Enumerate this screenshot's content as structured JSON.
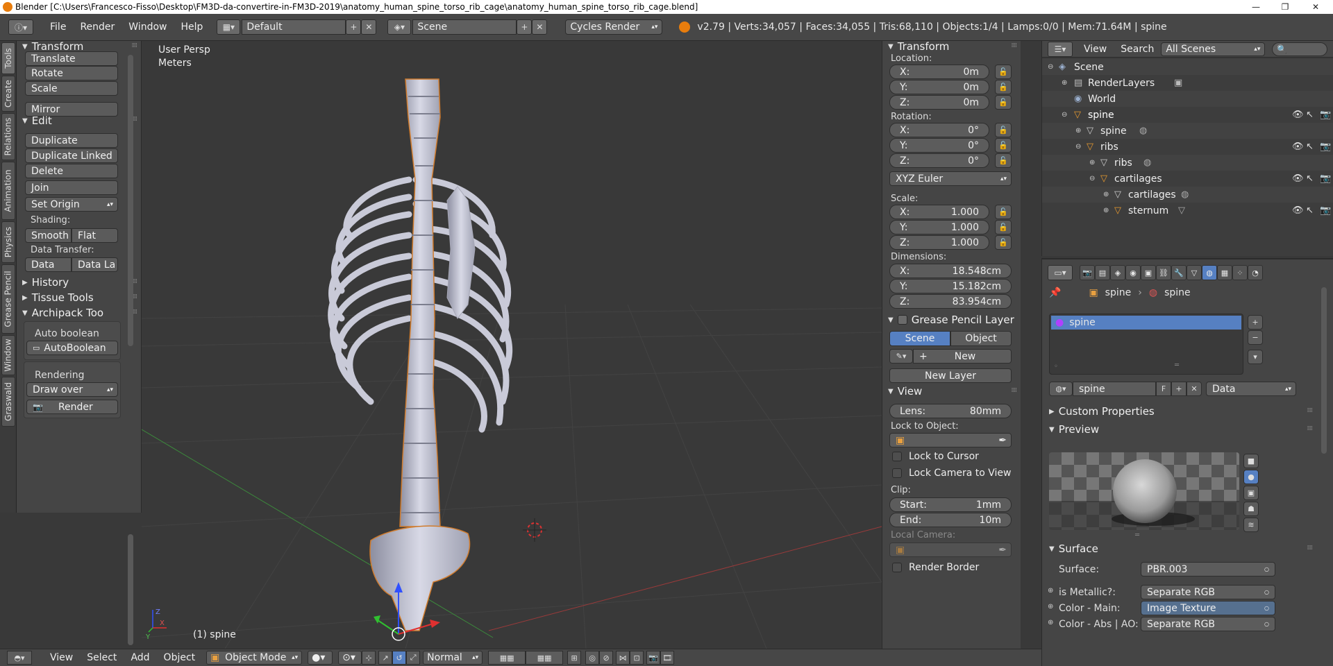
{
  "window": {
    "title": "Blender [C:\\Users\\Francesco-Fisso\\Desktop\\FM3D-da-convertire-in-FM3D-2019\\anatomy_human_spine_torso_rib_cage\\anatomy_human_spine_torso_rib_cage.blend]",
    "minimize": "—",
    "maximize": "❐",
    "close": "✕"
  },
  "header": {
    "menus": [
      "File",
      "Render",
      "Window",
      "Help"
    ],
    "screen_layout": "Default",
    "scene": "Scene",
    "render_engine": "Cycles Render",
    "stats": "v2.79 | Verts:34,057 | Faces:34,055 | Tris:68,110 | Objects:1/4 | Lamps:0/0 | Mem:71.64M | spine"
  },
  "tool_tabs": [
    "Tools",
    "Create",
    "Relations",
    "Animation",
    "Physics",
    "Grease Pencil",
    "Window",
    "Graswald"
  ],
  "toolshelf": {
    "transform": {
      "title": "Transform",
      "buttons": [
        "Translate",
        "Rotate",
        "Scale",
        "Mirror"
      ]
    },
    "edit": {
      "title": "Edit",
      "buttons": [
        "Duplicate",
        "Duplicate Linked",
        "Delete",
        "Join"
      ],
      "set_origin": "Set Origin",
      "shading_label": "Shading:",
      "smooth": "Smooth",
      "flat": "Flat",
      "data_transfer_label": "Data Transfer:",
      "data": "Data",
      "data_layout": "Data La"
    },
    "history": "History",
    "tissue_tools": "Tissue Tools",
    "archipack": {
      "title": "Archipack Too",
      "auto_boolean_label": "Auto boolean",
      "auto_boolean_btn": "AutoBoolean",
      "rendering_label": "Rendering",
      "draw_over": "Draw over",
      "render": "Render"
    }
  },
  "viewport": {
    "view_name": "User Persp",
    "units": "Meters",
    "object_label": "(1) spine"
  },
  "npanel": {
    "transform_title": "Transform",
    "location_label": "Location:",
    "location": [
      {
        "k": "X:",
        "v": "0m"
      },
      {
        "k": "Y:",
        "v": "0m"
      },
      {
        "k": "Z:",
        "v": "0m"
      }
    ],
    "rotation_label": "Rotation:",
    "rotation": [
      {
        "k": "X:",
        "v": "0°"
      },
      {
        "k": "Y:",
        "v": "0°"
      },
      {
        "k": "Z:",
        "v": "0°"
      }
    ],
    "rotation_mode": "XYZ Euler",
    "scale_label": "Scale:",
    "scale": [
      {
        "k": "X:",
        "v": "1.000"
      },
      {
        "k": "Y:",
        "v": "1.000"
      },
      {
        "k": "Z:",
        "v": "1.000"
      }
    ],
    "dimensions_label": "Dimensions:",
    "dimensions": [
      {
        "k": "X:",
        "v": "18.548cm"
      },
      {
        "k": "Y:",
        "v": "15.182cm"
      },
      {
        "k": "Z:",
        "v": "83.954cm"
      }
    ],
    "grease_pencil_title": "Grease Pencil Layer",
    "gp_scene": "Scene",
    "gp_object": "Object",
    "gp_new": "New",
    "gp_new_layer": "New Layer",
    "view_title": "View",
    "lens_label": "Lens:",
    "lens_value": "80mm",
    "lock_to_object_label": "Lock to Object:",
    "lock_to_cursor": "Lock to Cursor",
    "lock_camera_to_view": "Lock Camera to View",
    "clip_label": "Clip:",
    "clip_start_label": "Start:",
    "clip_start": "1mm",
    "clip_end_label": "End:",
    "clip_end": "10m",
    "local_camera_label": "Local Camera:",
    "render_border": "Render Border"
  },
  "outliner": {
    "view": "View",
    "search": "Search",
    "filter": "All Scenes",
    "items": [
      "Scene",
      "RenderLayers",
      "World",
      "spine",
      "spine",
      "ribs",
      "ribs",
      "cartilages",
      "cartilages",
      "sternum"
    ]
  },
  "properties": {
    "breadcrumb_obj": "spine",
    "breadcrumb_mat": "spine",
    "material_slot": "spine",
    "material_name": "spine",
    "fake_user": "F",
    "link": "Data",
    "custom_properties": "Custom Properties",
    "preview": "Preview",
    "surface_title": "Surface",
    "surface_label": "Surface:",
    "surface_value": "PBR.003",
    "rows": [
      {
        "label": "is Metallic?:",
        "value": "Separate RGB"
      },
      {
        "label": "Color - Main:",
        "value": "Image Texture"
      },
      {
        "label": "Color - Abs | AO:",
        "value": "Separate RGB"
      }
    ]
  },
  "bottombar": {
    "menus": [
      "View",
      "Select",
      "Add",
      "Object"
    ],
    "mode": "Object Mode",
    "pivot": "Normal"
  },
  "colors": {
    "selection": "#5680c2",
    "viewport_bg": "#393939",
    "panel_bg": "#454545"
  }
}
